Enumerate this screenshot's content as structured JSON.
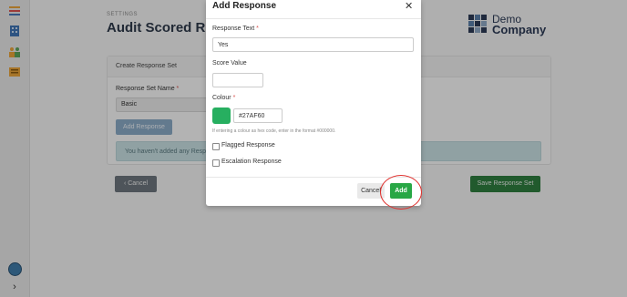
{
  "page": {
    "section_label": "SETTINGS",
    "title": "Audit Scored Respo",
    "brand": {
      "line1": "Demo",
      "line2": "Company"
    }
  },
  "sidebar": {
    "items": [
      {
        "icon": "list-icon"
      },
      {
        "icon": "building-icon"
      },
      {
        "icon": "people-icon"
      },
      {
        "icon": "audit-icon"
      }
    ],
    "bottom": [
      {
        "icon": "settings-logo-icon"
      },
      {
        "icon": "chevron-right-icon",
        "glyph": "›"
      }
    ]
  },
  "card": {
    "header": "Create Response Set",
    "set_name_label": "Response Set Name",
    "set_name_value": "Basic",
    "add_response_label": "Add Response",
    "info_text": "You haven't added any Respo"
  },
  "footer": {
    "cancel_label": "‹ Cancel",
    "save_label": "Save Response Set"
  },
  "modal": {
    "title": "Add Response",
    "close_glyph": "✕",
    "response_text_label": "Response Text",
    "response_text_value": "Yes",
    "score_label": "Score Value",
    "score_value": "",
    "colour_label": "Colour",
    "colour_hex": "#27AF60",
    "colour_hint": "If entering a colour as hex code, enter in the format #000000.",
    "flagged_label": "Flagged Response",
    "escalation_label": "Escalation Response",
    "cancel_label": "Cancel",
    "add_label": "Add",
    "required_mark": "*"
  },
  "colors": {
    "swatch": "#27AF60",
    "add_button": "#28a745",
    "highlight": "#e0322f"
  }
}
